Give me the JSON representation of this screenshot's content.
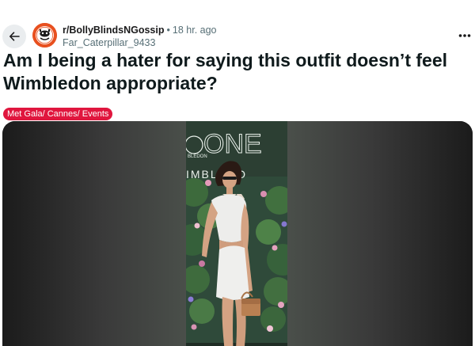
{
  "post": {
    "subreddit": "r/BollyBlindsNGossip",
    "separator": "•",
    "time": "18 hr. ago",
    "author": "Far_Caterpillar_9433",
    "title": "Am I being a hater for saying this outfit doesn’t feel Wimbledon appropriate?",
    "flair": "Met Gala/ Cannes/ Events",
    "flair_color": "#e0163e"
  },
  "icons": {
    "back": "arrow-left-icon",
    "more": "more-horizontal-icon",
    "avatar": "subreddit-avatar"
  },
  "photo_backdrop": {
    "line1": "ONE",
    "line2": "IMBLEDO",
    "small_text": "BLEDON"
  }
}
